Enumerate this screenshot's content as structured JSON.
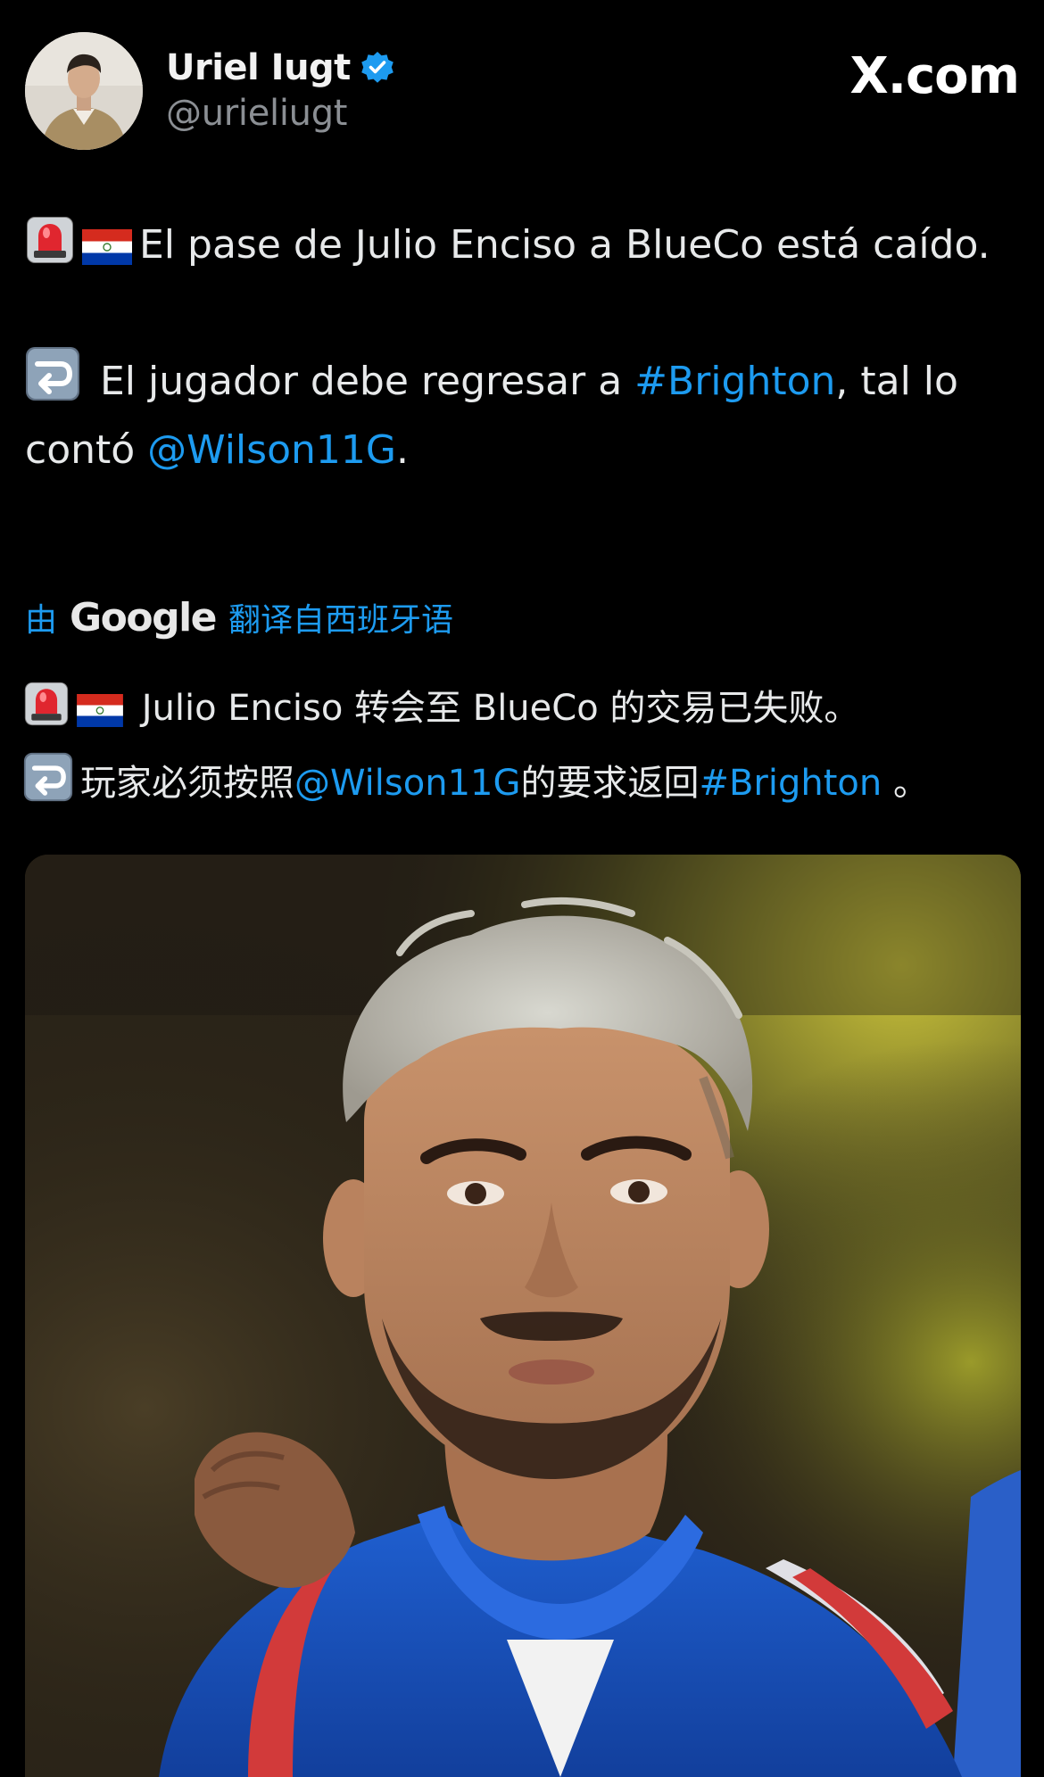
{
  "author": {
    "display_name": "Uriel Iugt",
    "handle": "@urieliugt",
    "verified": true
  },
  "brand": {
    "label": "X.com"
  },
  "tweet": {
    "line1_emoji": [
      "police-light-emoji",
      "paraguay-flag-emoji"
    ],
    "line1_text": "El pase de Julio Enciso a BlueCo está caído.",
    "line2_emoji": "right-arrow-curving-left-emoji",
    "line2_prefix": " El jugador debe regresar a ",
    "line2_hashtag": "#Brighton",
    "line2_middle": ", tal lo contó ",
    "line2_mention": "@Wilson11G",
    "line2_suffix": "."
  },
  "translation": {
    "prefix": "由",
    "provider": "Google",
    "label": "翻译自西班牙语",
    "line1_text": " Julio Enciso 转会至 BlueCo 的交易已失败。",
    "line2_prefix": "玩家必须按照",
    "line2_mention": "@Wilson11G",
    "line2_middle": "的要求返回",
    "line2_hashtag": "#Brighton",
    "line2_suffix": " 。"
  },
  "media": {
    "kind": "photo"
  },
  "colors": {
    "background": "#000000",
    "text": "#e7e9ea",
    "secondary": "#8b8f94",
    "link": "#1d9bf0",
    "verified": "#1d9bf0"
  }
}
